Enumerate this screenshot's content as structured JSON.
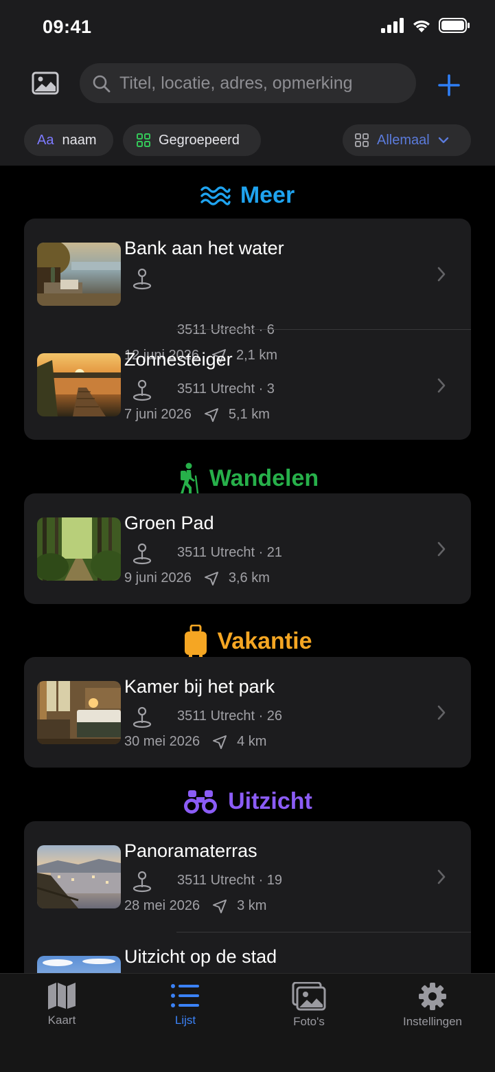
{
  "status_bar": {
    "time": "09:41"
  },
  "search": {
    "placeholder": "Titel, locatie, adres, opmerking"
  },
  "chips": {
    "sort_prefix": "Aa",
    "sort_label": "naam",
    "group_label": "Gegroepeerd",
    "filter_label": "Allemaal"
  },
  "sections": [
    {
      "title": "Meer",
      "color": "#1fa3ef",
      "icon": "water-waves-icon",
      "items": [
        {
          "title": "Bank aan het water",
          "address": "3511 Utrecht · 6",
          "date": "12 juni 2026",
          "distance": "2,1 km"
        },
        {
          "title": "Zonnesteiger",
          "address": "3511 Utrecht · 3",
          "date": "7 juni 2026",
          "distance": "5,1 km"
        }
      ]
    },
    {
      "title": "Wandelen",
      "color": "#27b04a",
      "icon": "hiker-icon",
      "items": [
        {
          "title": "Groen Pad",
          "address": "3511 Utrecht · 21",
          "date": "9 juni 2026",
          "distance": "3,6 km"
        }
      ]
    },
    {
      "title": "Vakantie",
      "color": "#f5a623",
      "icon": "suitcase-icon",
      "items": [
        {
          "title": "Kamer bij het park",
          "address": "3511 Utrecht · 26",
          "date": "30 mei 2026",
          "distance": "4 km"
        }
      ]
    },
    {
      "title": "Uitzicht",
      "color": "#8b5cf6",
      "icon": "binoculars-icon",
      "items": [
        {
          "title": "Panoramaterras",
          "address": "3511 Utrecht · 19",
          "date": "28 mei 2026",
          "distance": "3 km"
        },
        {
          "title": "Uitzicht op de stad"
        }
      ]
    }
  ],
  "tabbar": {
    "tabs": [
      {
        "label": "Kaart",
        "icon": "map-icon"
      },
      {
        "label": "Lijst",
        "icon": "list-icon",
        "active": true
      },
      {
        "label": "Foto's",
        "icon": "photos-icon"
      },
      {
        "label": "Instellingen",
        "icon": "gear-icon"
      }
    ]
  },
  "colors": {
    "accent": "#2f7ff6",
    "background": "#000000",
    "card": "#1c1c1e"
  }
}
